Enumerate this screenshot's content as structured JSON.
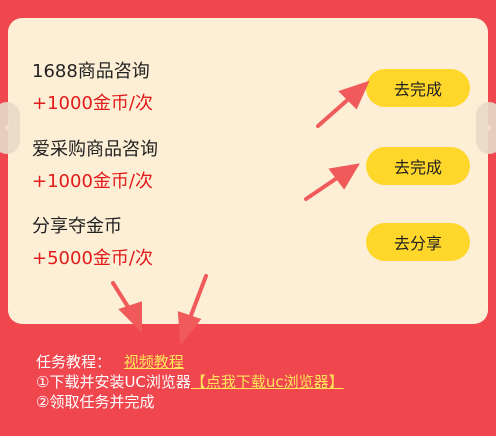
{
  "tasks": [
    {
      "name": "1688商品咨询",
      "reward": "+1000金币/次",
      "button": "去完成"
    },
    {
      "name": "爱采购商品咨询",
      "reward": "+1000金币/次",
      "button": "去完成"
    },
    {
      "name": "分享夺金币",
      "reward": "+5000金币/次",
      "button": "去分享"
    }
  ],
  "tutorial": {
    "label": "任务教程：",
    "video_link": "视频教程",
    "step1_text": "①下载并安装UC浏览器",
    "step1_link": "【点我下载uc浏览器】",
    "step2_text": "②领取任务并完成"
  },
  "nav": {
    "prev_icon": "‹",
    "next_icon": "›"
  },
  "colors": {
    "background": "#f0474f",
    "card": "#fcefd6",
    "button": "#ffd62a",
    "reward": "#e21b1b",
    "link": "#ffe35a",
    "arrow": "#f05a5a"
  }
}
